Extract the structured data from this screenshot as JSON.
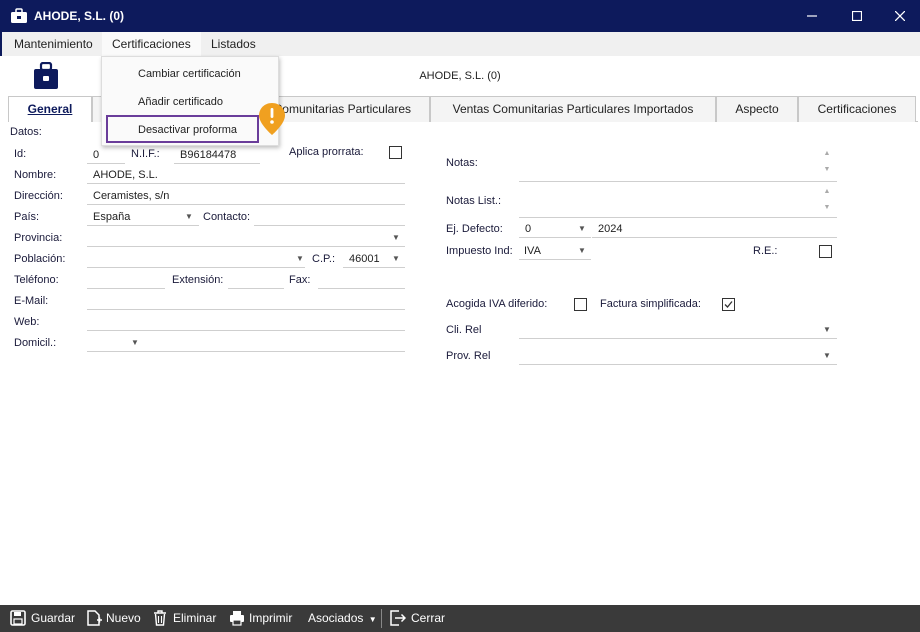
{
  "window": {
    "title": "AHODE, S.L. (0)"
  },
  "menubar": {
    "items": [
      "Mantenimiento",
      "Certificaciones",
      "Listados"
    ]
  },
  "dropdown": {
    "items": [
      "Cambiar certificación",
      "Añadir certificado",
      "Desactivar proforma"
    ]
  },
  "header": {
    "company": "AHODE, S.L. (0)"
  },
  "tabs": [
    "General",
    "Comunitarias Particulares",
    "Ventas Comunitarias Particulares Importados",
    "Aspecto",
    "Certificaciones"
  ],
  "form": {
    "datos_label": "Datos:",
    "id_label": "Id:",
    "id_value": "0",
    "nif_label": "N.I.F.:",
    "nif_value": "B96184478",
    "aplica_prorrata_label": "Aplica prorrata:",
    "aplica_prorrata": false,
    "nombre_label": "Nombre:",
    "nombre_value": "AHODE, S.L.",
    "direccion_label": "Dirección:",
    "direccion_value": "Ceramistes, s/n",
    "pais_label": "País:",
    "pais_value": "España",
    "contacto_label": "Contacto:",
    "contacto_value": "",
    "provincia_label": "Provincia:",
    "provincia_value": "",
    "poblacion_label": "Población:",
    "poblacion_value": "",
    "cp_label": "C.P.:",
    "cp_value": "46001",
    "telefono_label": "Teléfono:",
    "telefono_value": "",
    "extension_label": "Extensión:",
    "extension_value": "",
    "fax_label": "Fax:",
    "fax_value": "",
    "email_label": "E-Mail:",
    "email_value": "",
    "web_label": "Web:",
    "web_value": "",
    "domicil_label": "Domicil.:",
    "domicil_value": "",
    "notas_label": "Notas:",
    "notas_value": "",
    "notas_list_label": "Notas List.:",
    "notas_list_value": "",
    "ej_defecto_label": "Ej. Defecto:",
    "ej_defecto_value": "0",
    "ej_defecto_year": "2024",
    "impuesto_label": "Impuesto Ind:",
    "impuesto_value": "IVA",
    "re_label": "R.E.:",
    "re": false,
    "acogida_label": "Acogida IVA diferido:",
    "acogida": false,
    "factura_simplificada_label": "Factura simplificada:",
    "factura_simplificada": true,
    "cli_rel_label": "Cli. Rel",
    "cli_rel_value": "",
    "prov_rel_label": "Prov. Rel",
    "prov_rel_value": ""
  },
  "toolbar": {
    "guardar": "Guardar",
    "nuevo": "Nuevo",
    "eliminar": "Eliminar",
    "imprimir": "Imprimir",
    "asociados": "Asociados",
    "cerrar": "Cerrar"
  },
  "colors": {
    "titlebar": "#0d1a5c",
    "toolbar": "#3a3a3a",
    "highlight": "#6a3d9a",
    "warning": "#f0a020"
  }
}
